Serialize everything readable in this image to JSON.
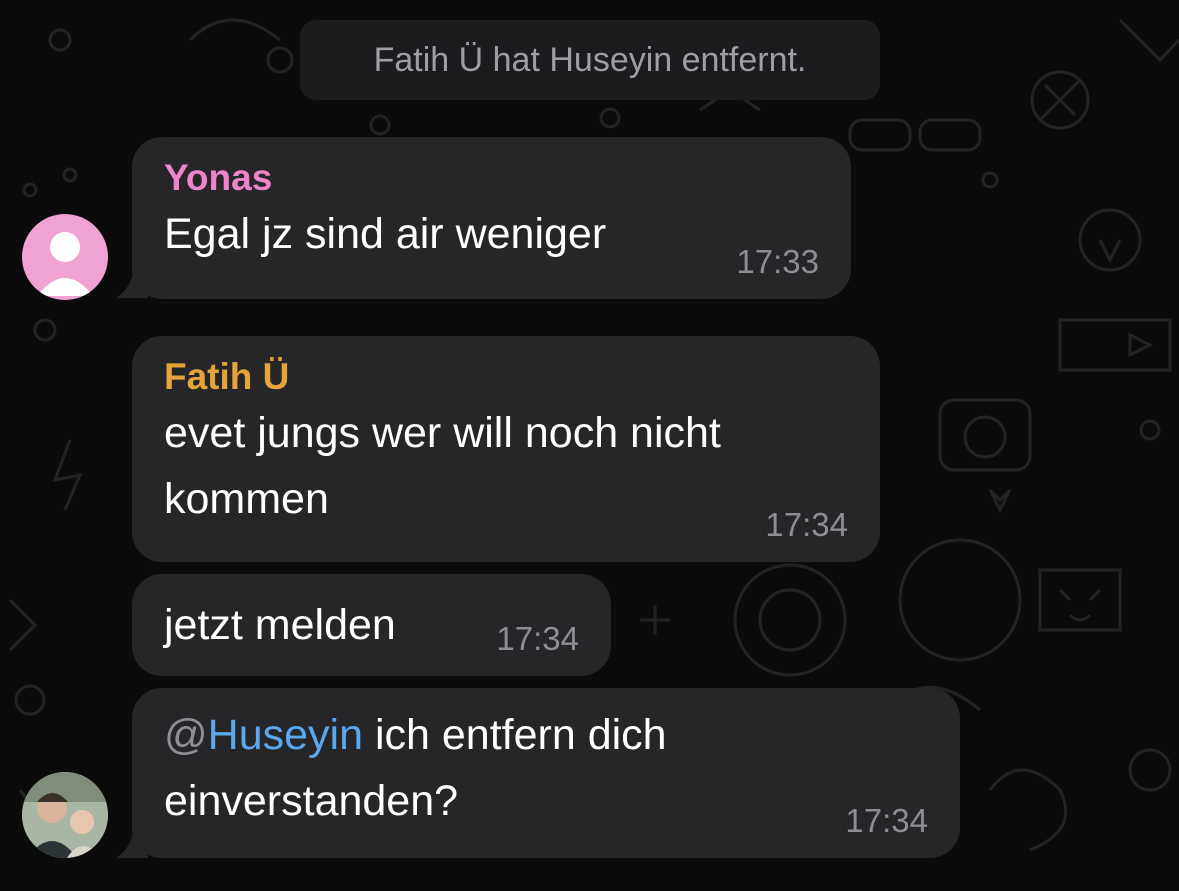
{
  "system_message": "Fatih Ü hat Huseyin entfernt.",
  "colors": {
    "background": "#0b0b0b",
    "bubble": "#262628",
    "sender_yonas": "#f084c8",
    "sender_fatih": "#e5a33a",
    "mention": "#59a8f0",
    "timestamp": "#8e8e93"
  },
  "messages": [
    {
      "sender": "Yonas",
      "text": "Egal jz sind air weniger",
      "time": "17:33",
      "avatar": "default-person-icon"
    },
    {
      "sender": "Fatih Ü",
      "lines": [
        "evet jungs wer will noch nicht",
        "kommen"
      ],
      "time": "17:34"
    },
    {
      "text": "jetzt melden",
      "time": "17:34"
    },
    {
      "mention_at": "@",
      "mention_name": "Huseyin",
      "line1_rest": " ich entfern dich",
      "line2": "einverstanden?",
      "time": "17:34",
      "avatar": "profile-photo"
    }
  ]
}
